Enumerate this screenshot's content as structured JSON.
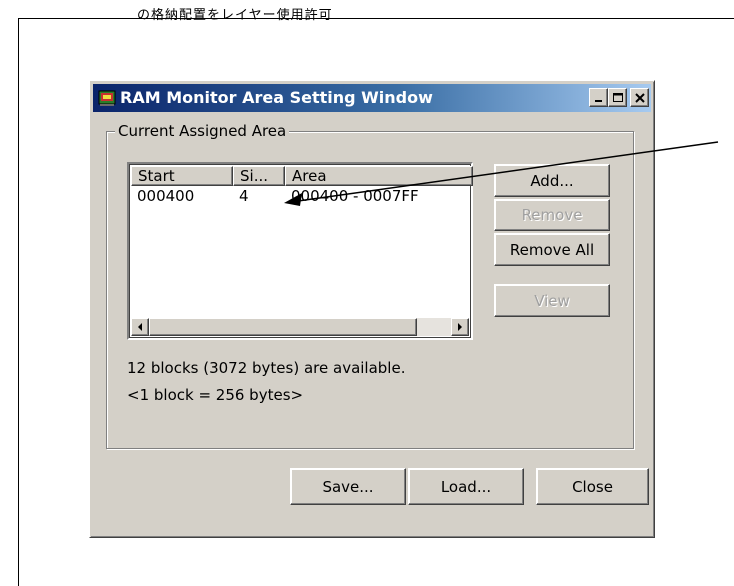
{
  "page": {
    "top_text_clipped": "の格納配置をレイヤー使用許可"
  },
  "window": {
    "title": "RAM Monitor Area Setting Window",
    "title_buttons": [
      "minimize",
      "maximize",
      "close"
    ],
    "group_label": "Current Assigned Area",
    "list": {
      "columns": [
        "Start",
        "Si...",
        "Area"
      ],
      "rows": [
        {
          "start": "000400",
          "size": "4",
          "area": "000400 - 0007FF"
        }
      ]
    },
    "side_buttons": {
      "add": "Add...",
      "remove": "Remove",
      "remove_all": "Remove All",
      "view": "View"
    },
    "info_line1": "12 blocks (3072 bytes) are available.",
    "info_line2": "<1 block = 256 bytes>",
    "bottom_buttons": {
      "save": "Save...",
      "load": "Load...",
      "close": "Close"
    }
  },
  "colors": {
    "face": "#d4d0c8",
    "title_start": "#0a246a",
    "title_end": "#a6caf0",
    "disabled_text": "#a0a0a0"
  }
}
